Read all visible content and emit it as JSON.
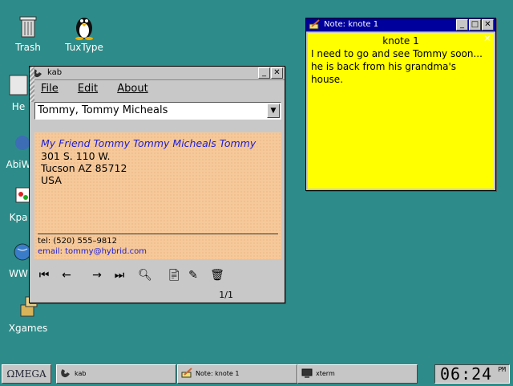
{
  "desktop": {
    "icons": [
      {
        "label": "Trash",
        "icon": "trash-icon"
      },
      {
        "label": "TuxType",
        "icon": "penguin-icon"
      },
      {
        "label": "He",
        "icon": "help-icon"
      },
      {
        "label": "AbiW",
        "icon": "abiword-icon"
      },
      {
        "label": "Kpa",
        "icon": "kpaint-icon"
      },
      {
        "label": "WW",
        "icon": "globe-icon"
      },
      {
        "label": "Xgames",
        "icon": "games-icon"
      }
    ]
  },
  "kab": {
    "title": "kab",
    "menu": {
      "file": "File",
      "edit": "Edit",
      "about": "About"
    },
    "selected_entry": "Tommy, Tommy Micheals",
    "card": {
      "name": "My Friend Tommy Tommy Micheals Tommy",
      "address1": "301 S. 110 W.",
      "address2": "Tucson AZ 85712",
      "country": "USA",
      "tel": "tel: (520) 555–9812",
      "email": "email: tommy@hybrid.com"
    },
    "pager": "1/1"
  },
  "knote": {
    "title": "Note: knote 1",
    "header": "knote 1",
    "text": "I need to go and see Tommy soon... he is back from his grandma's house."
  },
  "taskbar": {
    "start_label": "ΩMEGA",
    "items": [
      {
        "label": "kab",
        "icon": "phone-icon"
      },
      {
        "label": "Note: knote 1",
        "icon": "pencil-icon"
      },
      {
        "label": "xterm",
        "icon": "monitor-icon"
      }
    ],
    "clock": "06:24",
    "ampm": "PM"
  },
  "colors": {
    "desktop": "#2d8c89",
    "note": "#ffff00",
    "card": "#f6c99a",
    "link": "#2020d0",
    "active_title": "#00009c"
  }
}
